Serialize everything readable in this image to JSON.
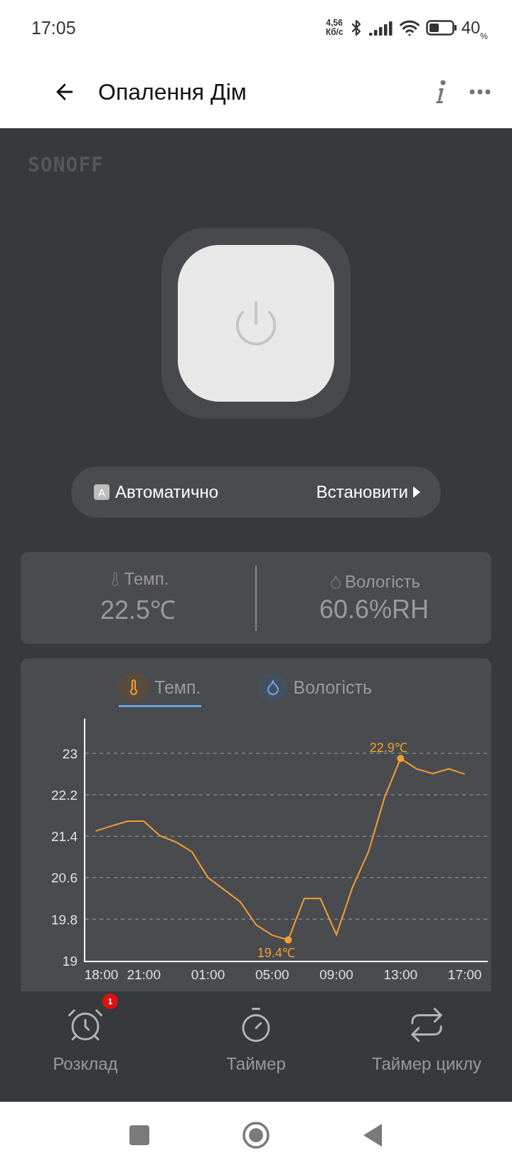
{
  "status_bar": {
    "time": "17:05",
    "net_speed": "4,56",
    "net_unit": "Кб/с",
    "battery": "40",
    "battery_unit": "%"
  },
  "header": {
    "title": "Опалення Дім"
  },
  "brand": {
    "logo": "SONOFF"
  },
  "power": {
    "on": false
  },
  "mode": {
    "badge": "A",
    "label": "Автоматично",
    "action": "Встановити"
  },
  "readings": [
    {
      "kind": "temperature",
      "label": "Темп.",
      "value": "22.5℃"
    },
    {
      "kind": "humidity",
      "label": "Вологість",
      "value": "60.6%RH"
    }
  ],
  "chart_tabs": [
    {
      "kind": "temperature",
      "label": "Темп.",
      "selected": true
    },
    {
      "kind": "humidity",
      "label": "Вологість",
      "selected": false
    }
  ],
  "chart_data": {
    "type": "line",
    "categories": [
      "18:00",
      null,
      null,
      "21:00",
      null,
      null,
      null,
      "01:00",
      null,
      null,
      null,
      "05:00",
      null,
      null,
      null,
      "09:00",
      null,
      null,
      null,
      "13:00",
      null,
      null,
      null,
      "17:00"
    ],
    "series": [
      {
        "color": "#f0a030",
        "values": [
          21.5,
          21.6,
          21.69,
          21.69,
          21.41,
          21.29,
          21.1,
          20.6,
          20.37,
          20.14,
          19.69,
          19.49,
          19.4,
          20.2,
          20.2,
          19.5,
          20.41,
          21.1,
          22.15,
          22.9,
          22.7,
          22.61,
          22.7,
          22.6
        ]
      }
    ],
    "ylim": [
      19,
      23.67
    ],
    "yticks": [
      19,
      19.8,
      20.6,
      21.4,
      22.2,
      23
    ],
    "grid": true,
    "annotations": [
      "19.4℃",
      "22.9℃"
    ]
  },
  "actions": [
    {
      "kind": "schedule",
      "label": "Розклад",
      "badge": "1"
    },
    {
      "kind": "timer",
      "label": "Таймер"
    },
    {
      "kind": "cycle",
      "label": "Таймер циклу"
    }
  ]
}
